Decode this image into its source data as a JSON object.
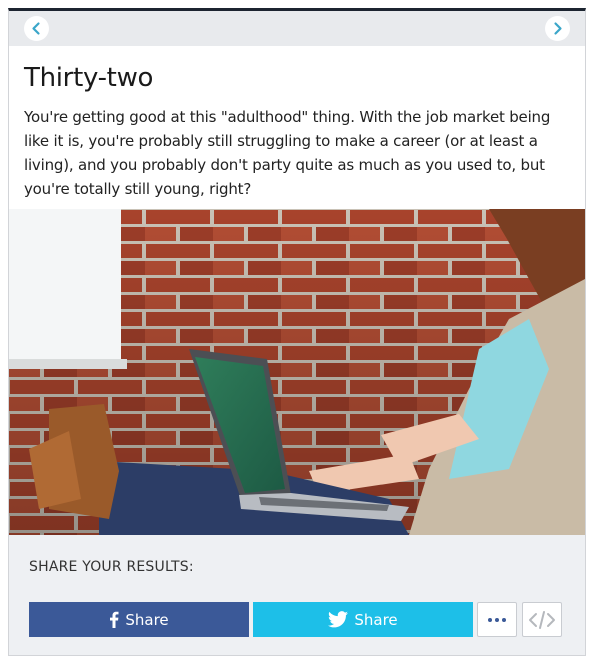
{
  "navigation": {
    "prev_icon": "chevron-left-icon",
    "next_icon": "chevron-right-icon"
  },
  "result": {
    "title": "Thirty-two",
    "description": "You're getting good at this \"adulthood\" thing. With the job market being like it is, you're probably still struggling to make a career (or at least a living), and you probably don't party quite as much as you used to, but you're totally still young, right?",
    "image_icon": "photo-woman-laptop-brick-wall"
  },
  "share": {
    "heading": "SHARE YOUR RESULTS:",
    "facebook": {
      "label": "Share",
      "icon": "facebook-icon",
      "color": "#3b5998"
    },
    "twitter": {
      "label": "Share",
      "icon": "twitter-icon",
      "color": "#1dbfe8"
    },
    "more_icon": "more-dots-icon",
    "embed_icon": "embed-code-icon"
  },
  "colors": {
    "accent": "#3aa6c9",
    "nav_bar": "#e8eaed",
    "share_bg": "#eef0f3"
  }
}
